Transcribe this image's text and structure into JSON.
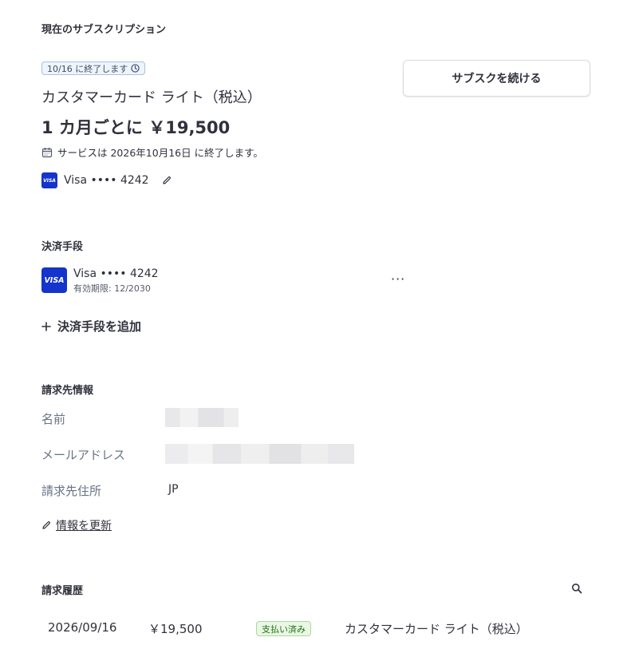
{
  "subscription": {
    "section_title": "現在のサブスクリプション",
    "badge": "10/16 に終了します",
    "plan_name": "カスタマーカード ライト（税込）",
    "price": "1 カ月ごとに ￥19,500",
    "end_note": "サービスは 2026年10月16日 に終了します。",
    "payment_brand": "VISA",
    "payment_label": "Visa •••• 4242",
    "continue_button": "サブスクを続ける"
  },
  "payment_methods": {
    "section_title": "決済手段",
    "card": {
      "brand": "VISA",
      "label": "Visa •••• 4242",
      "expiry": "有効期限: 12/2030"
    },
    "more_menu": "···",
    "add_button": "決済手段を追加"
  },
  "billing": {
    "section_title": "請求先情報",
    "name_label": "名前",
    "email_label": "メールアドレス",
    "address_label": "請求先住所",
    "address_value": "JP",
    "update_link": "情報を更新"
  },
  "history": {
    "section_title": "請求履歴",
    "rows": [
      {
        "date": "2026/09/16",
        "amount": "￥19,500",
        "status": "支払い済み",
        "description": "カスタマーカード ライト（税込）"
      }
    ]
  },
  "colors": {
    "visa_blue": "#1434cb",
    "badge_border": "#a9c1e0",
    "paid_green": "#1f6d12",
    "text": "#30313d"
  }
}
